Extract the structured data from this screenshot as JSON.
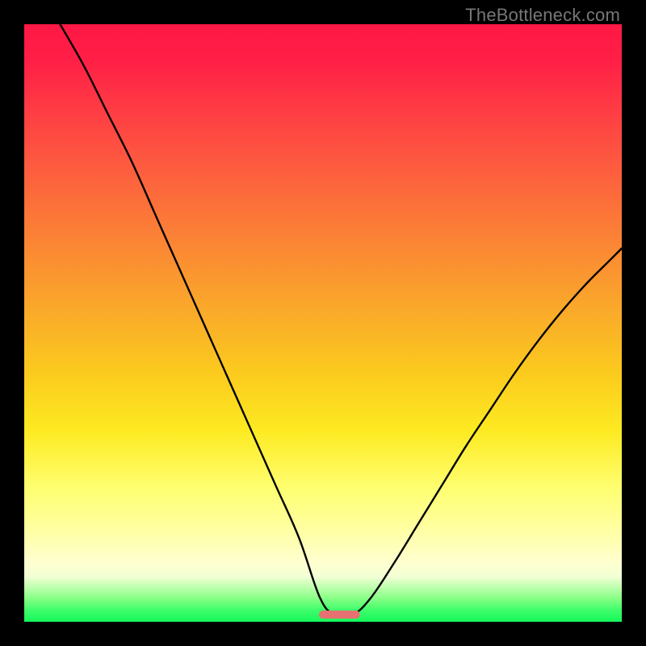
{
  "watermark": "TheBottleneck.com",
  "chart_data": {
    "type": "line",
    "title": "",
    "xlabel": "",
    "ylabel": "",
    "xlim": [
      0,
      1
    ],
    "ylim": [
      0,
      1
    ],
    "grid": false,
    "legend": false,
    "annotations": [],
    "description": "V-shaped curve on a vertical rainbow gradient background; left branch descends steeply from top-left to a flat trough near x≈0.50–0.55 at y≈0.01, right branch rises to mid-height at the right edge. A small reddish marker segment sits at the trough.",
    "series": [
      {
        "name": "curve",
        "x": [
          0.06,
          0.1,
          0.14,
          0.18,
          0.22,
          0.26,
          0.3,
          0.34,
          0.38,
          0.42,
          0.46,
          0.495,
          0.52,
          0.55,
          0.58,
          0.62,
          0.66,
          0.7,
          0.74,
          0.78,
          0.82,
          0.86,
          0.9,
          0.94,
          0.98,
          1.0
        ],
        "y": [
          1.0,
          0.93,
          0.85,
          0.77,
          0.68,
          0.59,
          0.5,
          0.41,
          0.32,
          0.23,
          0.14,
          0.04,
          0.012,
          0.012,
          0.04,
          0.1,
          0.165,
          0.23,
          0.295,
          0.355,
          0.415,
          0.47,
          0.52,
          0.565,
          0.605,
          0.625
        ]
      }
    ],
    "trough_marker": {
      "x_start": 0.5,
      "x_end": 0.555,
      "y": 0.012,
      "color": "#e77070"
    }
  }
}
